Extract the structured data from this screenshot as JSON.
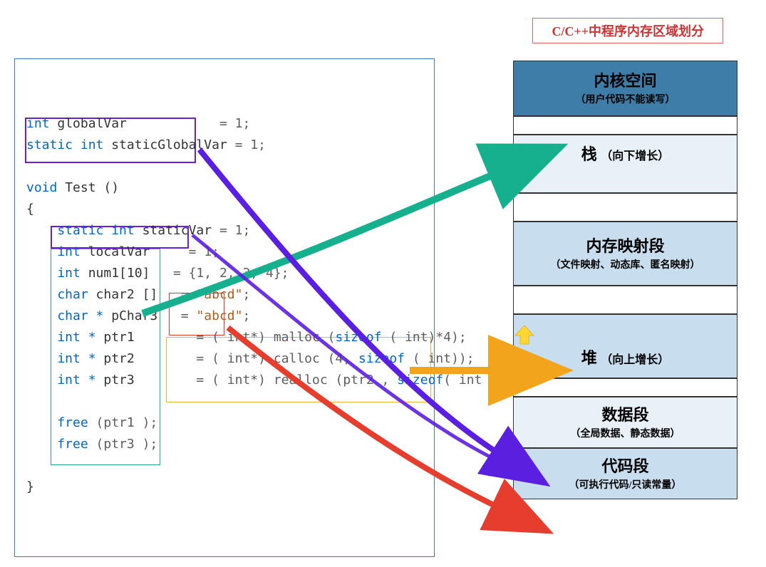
{
  "title": "C/C++中程序内存区域划分",
  "code": {
    "l1a": "int ",
    "l1b": "globalVar",
    "l1c": "            ",
    "l1d": "= 1;",
    "l2a": "static int ",
    "l2b": "staticGlobalVar",
    "l2c": " = 1;",
    "l4a": "void ",
    "l4b": "Test ()",
    "l5": "{",
    "l6a": "    static int ",
    "l6b": "staticVar",
    "l6c": " = 1;",
    "l7a": "    int ",
    "l7b": "localVar",
    "l7c": "     = 1;",
    "l8a": "    int ",
    "l8b": "num1[10]",
    "l8c": "   = {1, 2, 3, 4};",
    "l9a": "    char ",
    "l9b": "char2 []",
    "l9c": "   = ",
    "l9d": "\"abcd\"",
    "l9e": ";",
    "l10a": "    char * ",
    "l10b": "pChar3",
    "l10c": "   = ",
    "l10d": "\"abcd\"",
    "l10e": ";",
    "l11a": "    int * ",
    "l11b": "ptr1",
    "l11c": "        = ( int*) ",
    "l11d": "malloc",
    "l11e": " (",
    "l11f": "sizeof",
    "l11g": " ( int)*4);",
    "l12a": "    int * ",
    "l12b": "ptr2",
    "l12c": "        = ( int*) ",
    "l12d": "calloc",
    "l12e": " (4, ",
    "l12f": "sizeof",
    "l12g": " ( int));",
    "l13a": "    int * ",
    "l13b": "ptr3",
    "l13c": "        = ( int*) ",
    "l13d": "realloc",
    "l13e": " (ptr2 , ",
    "l13f": "sizeof",
    "l13g": "( int )*4);",
    "l15a": "    free ",
    "l15b": "(ptr1 );",
    "l16a": "    free ",
    "l16b": "(ptr3 );",
    "l18": "}"
  },
  "mem": {
    "kernel_t": "内核空间",
    "kernel_s": "（用户代码不能读写）",
    "stack_t": "栈",
    "stack_s": "（向下增长）",
    "mmap_t": "内存映射段",
    "mmap_s": "（文件映射、动态库、匿名映射）",
    "heap_t": "堆",
    "heap_s": "（向上增长）",
    "data_t": "数据段",
    "data_s": "（全局数据、静态数据）",
    "text_t": "代码段",
    "text_s": "（可执行代码/只读常量）"
  }
}
